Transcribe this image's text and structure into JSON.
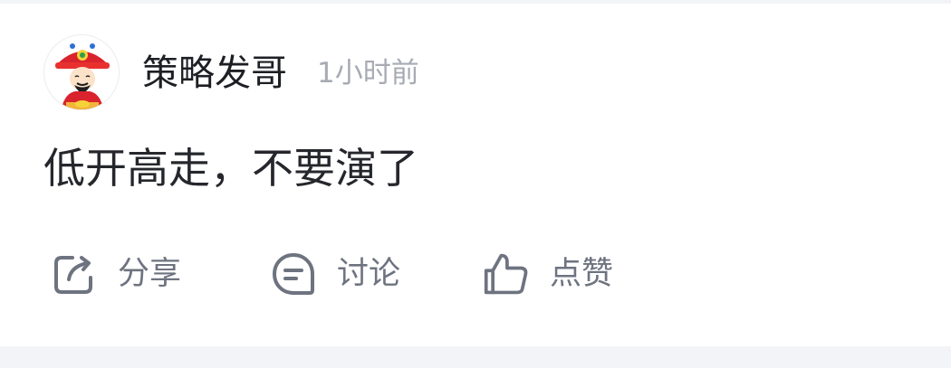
{
  "post": {
    "author": "策略发哥",
    "time": "1小时前",
    "content": "低开高走，不要演了",
    "avatar_icon": "fortune-god-avatar"
  },
  "actions": {
    "share": {
      "label": "分享",
      "icon": "share-icon"
    },
    "discuss": {
      "label": "讨论",
      "icon": "comment-icon"
    },
    "like": {
      "label": "点赞",
      "icon": "thumbs-up-icon"
    }
  },
  "colors": {
    "background": "#ffffff",
    "separator": "#f3f4f7",
    "author_text": "#1d1f24",
    "time_text": "#a7abb3",
    "content_text": "#25272c",
    "action_text": "#6e7380",
    "icon_stroke": "#6e7380"
  }
}
